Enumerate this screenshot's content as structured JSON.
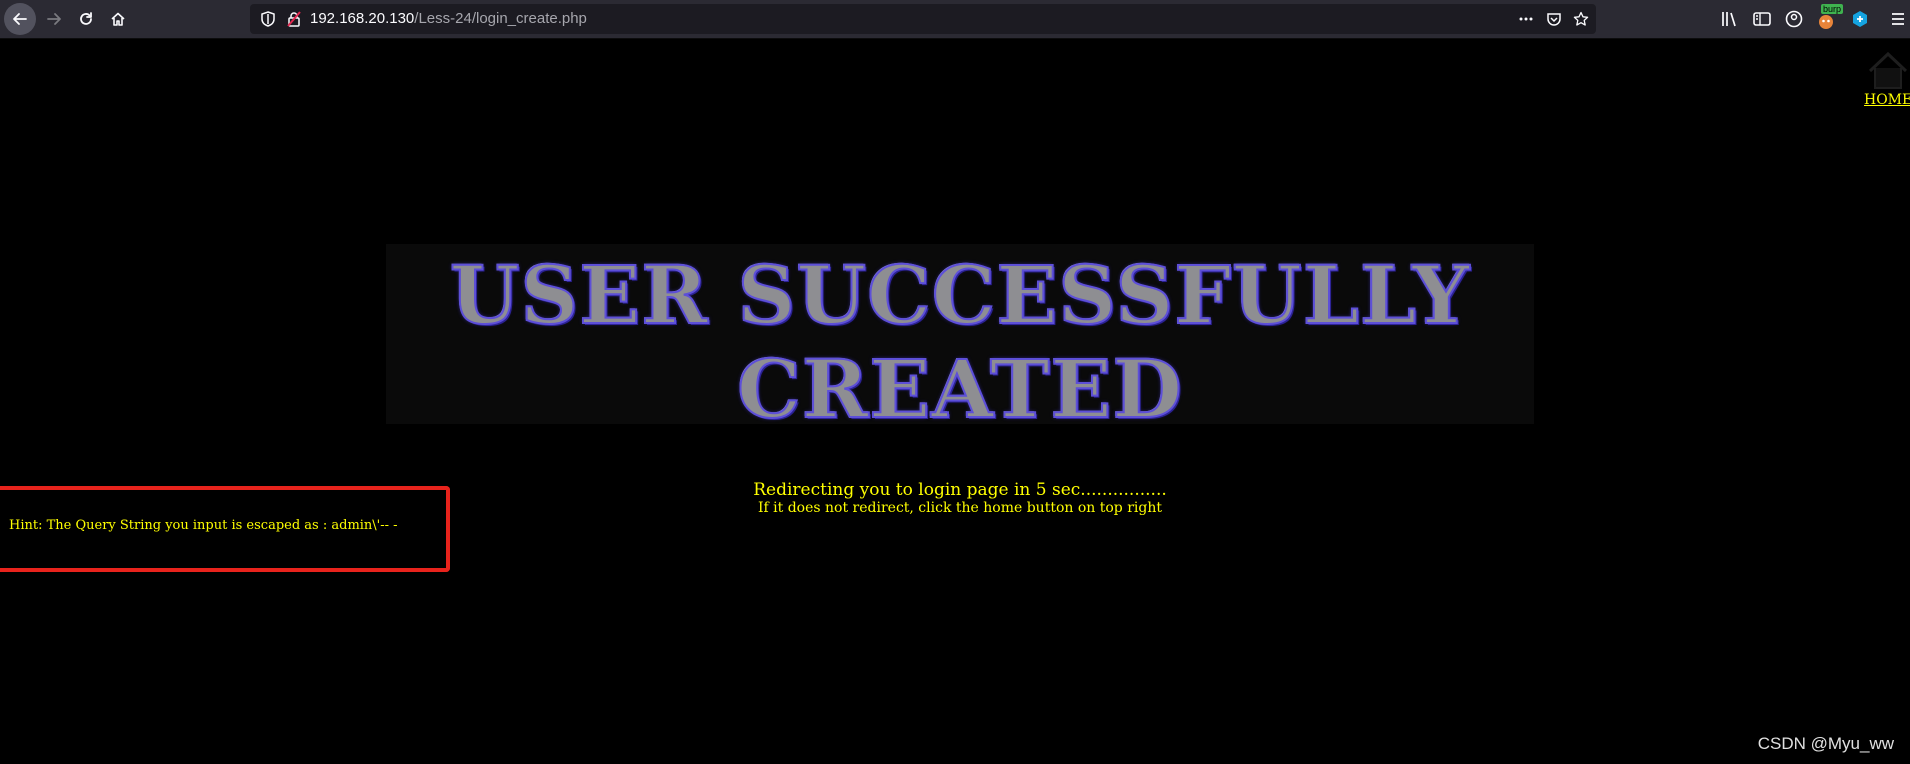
{
  "browser": {
    "url_host": "192.168.20.130",
    "url_path": "/Less-24/login_create.php",
    "burp_badge": "burp"
  },
  "page": {
    "home_label": "HOME",
    "banner_line1": "USER SUCCESSFULLY",
    "banner_line2": "CREATED",
    "redirect_text": "Redirecting you to login page in 5 sec................",
    "redirect_subtext": "If it does not redirect, click the home button on top right",
    "hint_text": "Hint: The Query String you input is escaped as : admin\\'-- -",
    "watermark": "CSDN @Myu_ww"
  },
  "colors": {
    "text_yellow": "#ffff00",
    "highlight_red": "#e8231c",
    "banner_outline": "#5d4fd8"
  }
}
